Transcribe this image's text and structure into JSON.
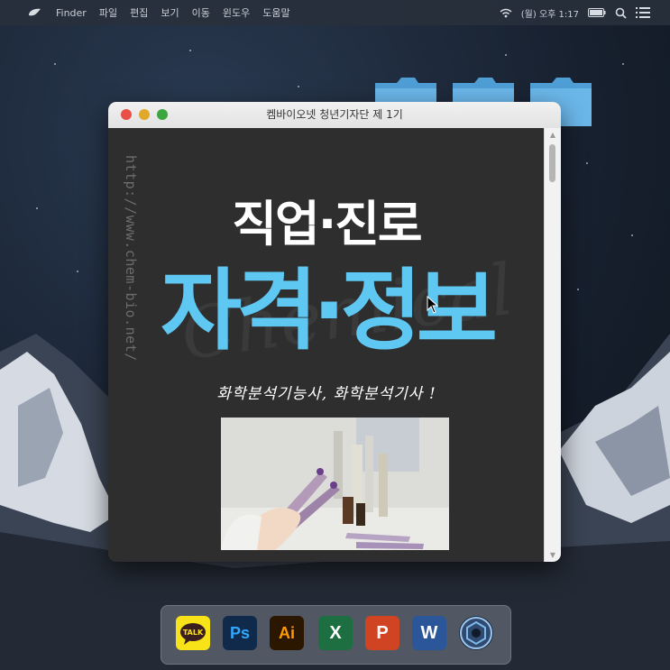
{
  "menubar": {
    "app_name": "Finder",
    "items": [
      "파일",
      "편집",
      "보기",
      "이동",
      "윈도우",
      "도움말"
    ],
    "clock": "(월) 오후 1:17"
  },
  "window": {
    "title": "켐바이오넷 청년기자단 제 1기"
  },
  "content": {
    "vertical_url": "http://www.chem-bio.net/",
    "watermark": "Chemical",
    "heading_line1": "직업·진로",
    "heading_line2": "자격·정보",
    "subtitle": "화학분석기능사, 화학분석기사 !"
  },
  "dock": {
    "apps": [
      {
        "name": "kakaotalk-icon",
        "label": "TALK",
        "bg": "#f7e317",
        "fg": "#3b1e1e"
      },
      {
        "name": "photoshop-icon",
        "label": "Ps",
        "bg": "#0f2a4a",
        "fg": "#31a8ff"
      },
      {
        "name": "illustrator-icon",
        "label": "Ai",
        "bg": "#2b1600",
        "fg": "#ff9a00"
      },
      {
        "name": "excel-icon",
        "label": "X",
        "bg": "#1d6f42",
        "fg": "#ffffff"
      },
      {
        "name": "powerpoint-icon",
        "label": "P",
        "bg": "#d04423",
        "fg": "#ffffff"
      },
      {
        "name": "word-icon",
        "label": "W",
        "bg": "#2b579a",
        "fg": "#ffffff"
      },
      {
        "name": "aperture-icon",
        "label": "",
        "bg": "#1b2d44",
        "fg": "#7fb8ea"
      }
    ]
  },
  "colors": {
    "accent_blue": "#5ec8f2",
    "window_bg": "#2e2e2e"
  }
}
